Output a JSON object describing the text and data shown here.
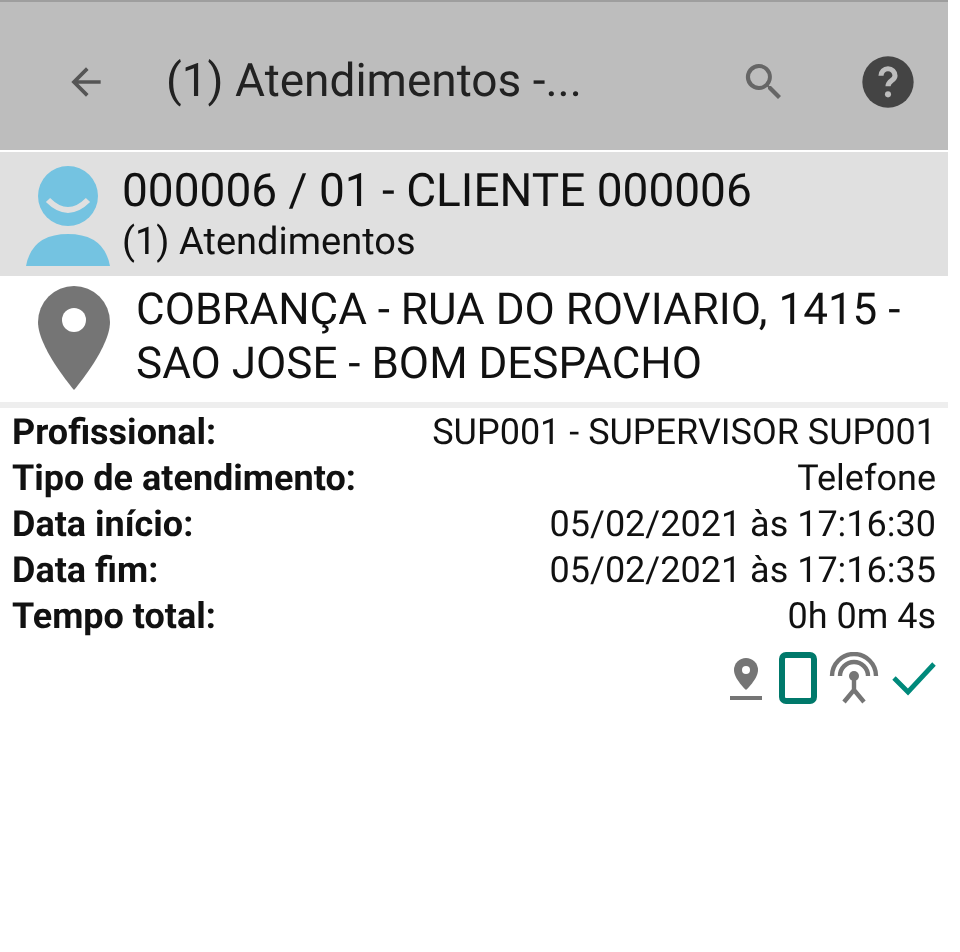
{
  "toolbar": {
    "title": "(1) Atendimentos -..."
  },
  "client": {
    "title": "000006 / 01 - CLIENTE 000006",
    "subtitle": "(1) Atendimentos"
  },
  "address": {
    "text": "COBRANÇA - RUA DO ROVIARIO, 1415 - SAO JOSE - BOM DESPACHO"
  },
  "details": [
    {
      "label": "Profissional:",
      "value": "SUP001 - SUPERVISOR SUP001"
    },
    {
      "label": "Tipo de atendimento:",
      "value": "Telefone"
    },
    {
      "label": "Data início:",
      "value": "05/02/2021 às 17:16:30"
    },
    {
      "label": "Data fim:",
      "value": "05/02/2021 às 17:16:35"
    },
    {
      "label": "Tempo total:",
      "value": "0h 0m 4s"
    }
  ]
}
